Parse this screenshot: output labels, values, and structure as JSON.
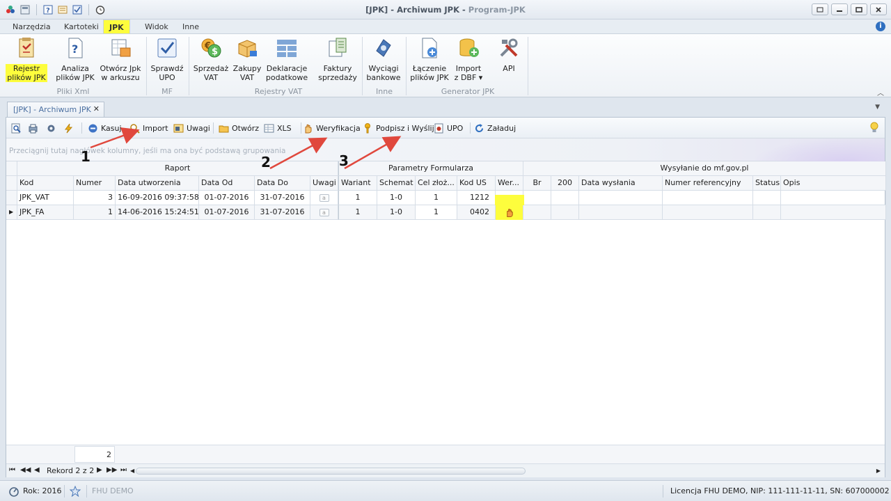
{
  "window": {
    "title": "[JPK] - Archiwum JPK",
    "app_name": "Program-JPK"
  },
  "tabs": [
    "Narzędzia",
    "Kartoteki",
    "JPK",
    "Widok",
    "Inne"
  ],
  "active_tab": "JPK",
  "ribbon": {
    "buttons": [
      {
        "line1": "Rejestr",
        "line2": "plików JPK",
        "icon": "register-icon",
        "highlighted": true
      },
      {
        "line1": "Analiza",
        "line2": "plików JPK",
        "icon": "help-doc-icon"
      },
      {
        "line1": "Otwórz Jpk",
        "line2": "w arkuszu",
        "icon": "sheet-icon"
      },
      {
        "line1": "Sprawdź",
        "line2": "UPO",
        "icon": "check-icon"
      },
      {
        "line1": "Sprzedaż",
        "line2": "VAT",
        "icon": "money-icon"
      },
      {
        "line1": "Zakupy",
        "line2": "VAT",
        "icon": "cart-icon"
      },
      {
        "line1": "Deklaracje",
        "line2": "podatkowe",
        "icon": "grid-icon"
      },
      {
        "line1": "Faktury",
        "line2": "sprzedaży",
        "icon": "invoice-icon"
      },
      {
        "line1": "Wyciągi",
        "line2": "bankowe",
        "icon": "bank-icon"
      },
      {
        "line1": "Łączenie",
        "line2": "plików JPK",
        "icon": "merge-icon"
      },
      {
        "line1": "Import",
        "line2": "z DBF ▾",
        "icon": "database-icon"
      },
      {
        "line1": "API",
        "line2": "",
        "icon": "tools-icon"
      }
    ],
    "groups": [
      "Pliki Xml",
      "MF",
      "Rejestry VAT",
      "Inne",
      "Generator JPK"
    ]
  },
  "doc_tab": "[JPK] - Archiwum JPK",
  "toolbar": {
    "kasuj": "Kasuj",
    "import": "Import",
    "uwagi": "Uwagi",
    "otworz": "Otwórz",
    "xls": "XLS",
    "weryfikacja": "Weryfikacja",
    "podpisz": "Podpisz i Wyślij",
    "upo": "UPO",
    "zaladuj": "Załaduj"
  },
  "group_hint": "Przeciągnij tutaj nagłówek kolumny, jeśli ma ona być podstawą grupowania",
  "bands": {
    "raport": "Raport",
    "parametry": "Parametry Formularza",
    "wysylanie": "Wysyłanie do mf.gov.pl"
  },
  "columns": [
    "Kod",
    "Numer",
    "Data utworzenia",
    "Data Od",
    "Data Do",
    "Uwagi",
    "Wariant",
    "Schemat",
    "Cel złoż...",
    "Kod US",
    "Wer...",
    "Br",
    "200",
    "Data wysłania",
    "Numer referencyjny",
    "Status",
    "Opis"
  ],
  "rows": [
    {
      "kod": "JPK_VAT",
      "numer": "3",
      "data_utworzenia": "16-09-2016 09:37:58",
      "data_od": "01-07-2016",
      "data_do": "31-07-2016",
      "wariant": "1",
      "schemat": "1-0",
      "cel": "1",
      "kod_us": "1212"
    },
    {
      "kod": "JPK_FA",
      "numer": "1",
      "data_utworzenia": "14-06-2016 15:24:51",
      "data_od": "01-07-2016",
      "data_do": "31-07-2016",
      "wariant": "1",
      "schemat": "1-0",
      "cel": "1",
      "kod_us": "0402"
    }
  ],
  "summary_count": "2",
  "navigator": {
    "record": "Rekord 2 z 2"
  },
  "annotations": [
    "1",
    "2",
    "3"
  ],
  "status": {
    "year": "Rok: 2016",
    "company": "FHU DEMO",
    "license": "Licencja FHU DEMO,  NIP: 111-111-11-11,  SN: 607000002"
  },
  "colors": {
    "highlight": "#fdfd3d",
    "arrow": "#e0483d",
    "accent": "#2f6fc0"
  }
}
